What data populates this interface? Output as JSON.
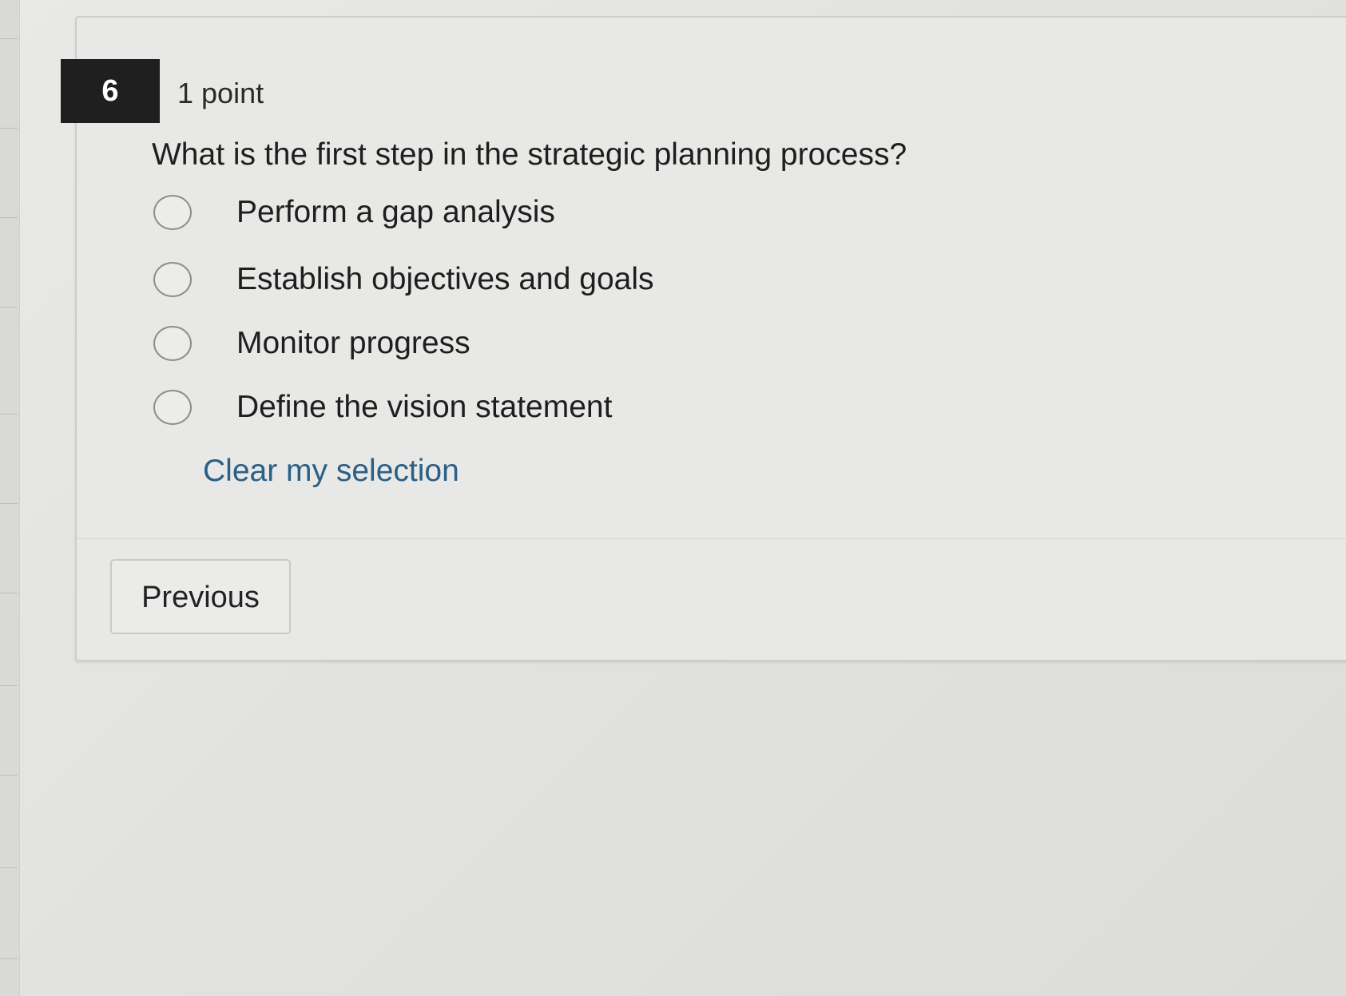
{
  "question": {
    "number": "6",
    "points": "1 point",
    "text": "What is the first step in the strategic planning process?"
  },
  "options": [
    {
      "label": "Perform a gap analysis",
      "selected": false
    },
    {
      "label": "Establish objectives and goals",
      "selected": false
    },
    {
      "label": "Monitor progress",
      "selected": false
    },
    {
      "label": "Define the vision statement",
      "selected": false
    }
  ],
  "actions": {
    "clear_label": "Clear my selection",
    "previous_label": "Previous"
  },
  "colors": {
    "badge_bg": "#1f1f1f",
    "link": "#2a5f86",
    "page_bg": "#e4e4e2"
  }
}
